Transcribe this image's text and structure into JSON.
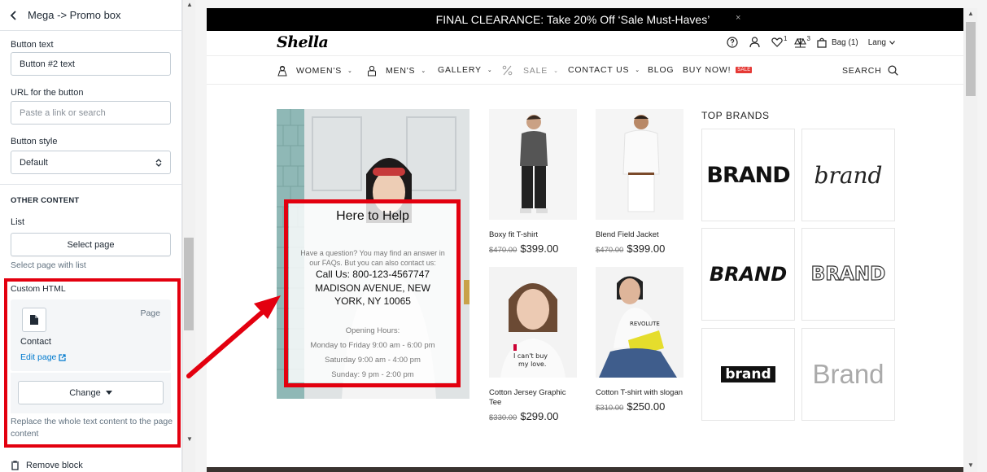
{
  "panel": {
    "title": "Mega -> Promo box",
    "button_text_label": "Button text",
    "button_text_value": "Button #2 text",
    "url_label": "URL for the button",
    "url_placeholder": "Paste a link or search",
    "button_style_label": "Button style",
    "button_style_value": "Default",
    "other_content_heading": "OTHER CONTENT",
    "list_label": "List",
    "select_page_button": "Select page",
    "select_page_hint": "Select page with list",
    "custom_html_label": "Custom HTML",
    "page_card": {
      "type": "Page",
      "name": "Contact",
      "edit_link": "Edit page"
    },
    "change_button": "Change",
    "replace_hint": "Replace the whole text content to the page content",
    "remove_block": "Remove block"
  },
  "preview": {
    "announcement": "FINAL CLEARANCE: Take 20% Off ‘Sale Must-Haves’",
    "announcement_close": "×",
    "logo": "Shella",
    "header": {
      "wishlist_count": "1",
      "compare_count": "3",
      "bag_label": "Bag (1)",
      "lang_label": "Lang"
    },
    "nav": {
      "items": [
        "WOMEN'S",
        "MEN'S",
        "GALLERY",
        "SALE",
        "CONTACT US",
        "BLOG",
        "BUY NOW!"
      ],
      "sale_badge": "SALE",
      "search_label": "SEARCH"
    },
    "promo": {
      "title": "Here to Help",
      "intro": "Have a question? You may find an answer in our FAQs. But you can also contact us:",
      "phone": "Call Us: 800-123-4567747",
      "address": "MADISON AVENUE, NEW YORK, NY 10065",
      "hours_title": "Opening Hours:",
      "hours": [
        "Monday to Friday 9:00 am - 6:00 pm",
        "Saturday 9:00 am - 4:00 pm",
        "Sunday: 9 pm - 2:00 pm"
      ]
    },
    "products": [
      {
        "name": "Boxy fit T-shirt",
        "old_price": "$470.00",
        "price": "$399.00"
      },
      {
        "name": "Blend Field Jacket",
        "old_price": "$470.00",
        "price": "$399.00"
      },
      {
        "name": "Cotton Jersey Graphic Tee",
        "old_price": "$330.00",
        "price": "$299.00"
      },
      {
        "name": "Cotton T-shirt with slogan",
        "old_price": "$310.00",
        "price": "$250.00"
      }
    ],
    "brands_title": "TOP BRANDS",
    "brands": [
      "BRAND",
      "brand",
      "BRAND",
      "BRAND",
      "brand",
      "Brand"
    ]
  },
  "colors": {
    "annotation_red": "#e3000f",
    "link_blue": "#007ace",
    "sale_red": "#e53935"
  }
}
